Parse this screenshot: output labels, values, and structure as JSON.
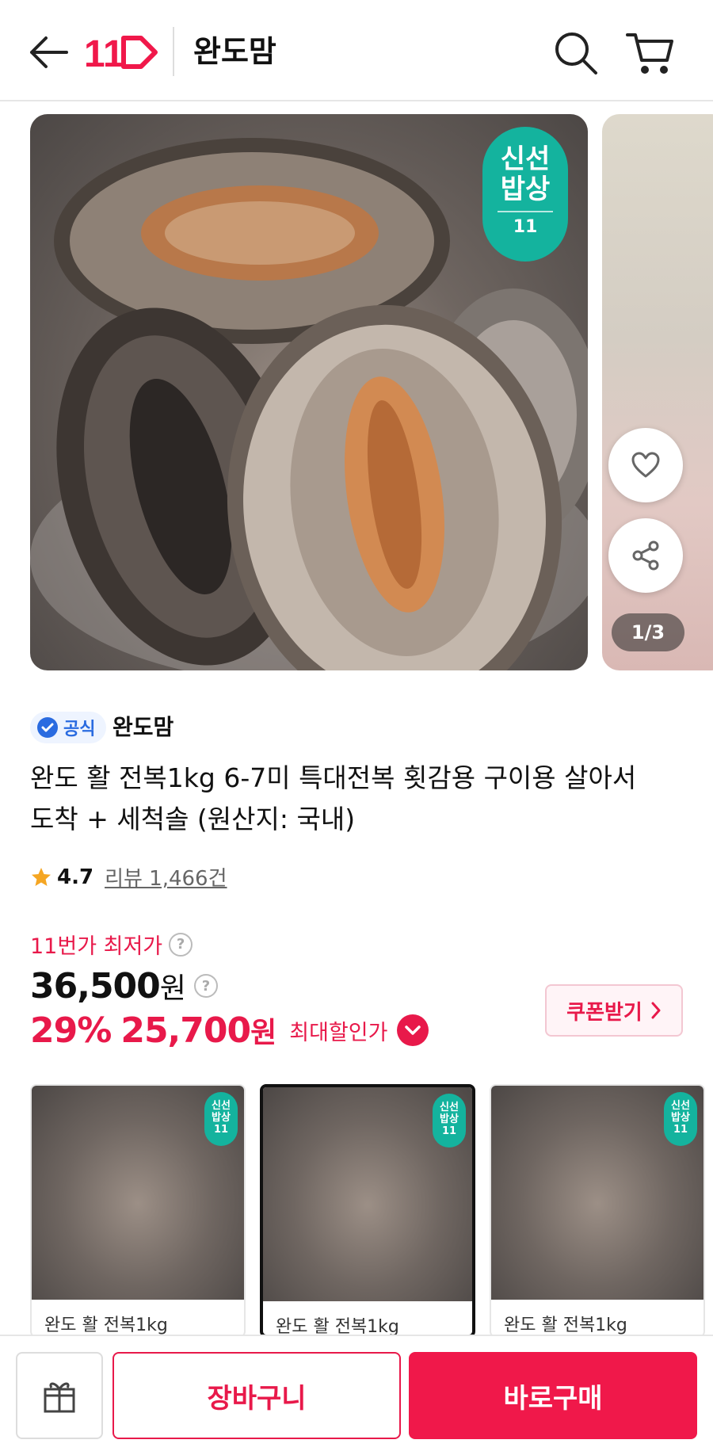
{
  "header": {
    "logo_text": "11",
    "store_name": "완도맘"
  },
  "hero": {
    "badge_line1": "신선",
    "badge_line2": "밥상",
    "badge_logo": "11",
    "pager": "1/3"
  },
  "product": {
    "official_label": "공식",
    "seller": "완도맘",
    "title": "완도 활 전복1kg 6-7미 특대전복 횟감용 구이용 살아서도착 + 세척솔 (원산지: 국내)",
    "rating": "4.7",
    "review_text": "리뷰 1,466건"
  },
  "price": {
    "lowest_label": "11번가 최저가",
    "original": "36,500",
    "won": "원",
    "discount_pct": "29%",
    "sale": "25,700",
    "max_discount_label": "최대할인가",
    "coupon_label": "쿠폰받기"
  },
  "options": [
    {
      "title": "완도 활 전복1kg",
      "badge1": "신선",
      "badge2": "밥상",
      "badge3": "11"
    },
    {
      "title": "완도 활 전복1kg",
      "badge1": "신선",
      "badge2": "밥상",
      "badge3": "11"
    },
    {
      "title": "완도 활 전복1kg",
      "badge1": "신선",
      "badge2": "밥상",
      "badge3": "11"
    }
  ],
  "bottom": {
    "cart_label": "장바구니",
    "buy_label": "바로구매"
  },
  "colors": {
    "brand": "#e8194a",
    "fresh_badge": "#14b39e"
  },
  "icons": [
    "back-arrow-icon",
    "search-icon",
    "cart-icon",
    "heart-icon",
    "share-icon",
    "verified-icon",
    "star-icon",
    "chevron-down-icon",
    "chevron-right-icon",
    "gift-icon"
  ]
}
